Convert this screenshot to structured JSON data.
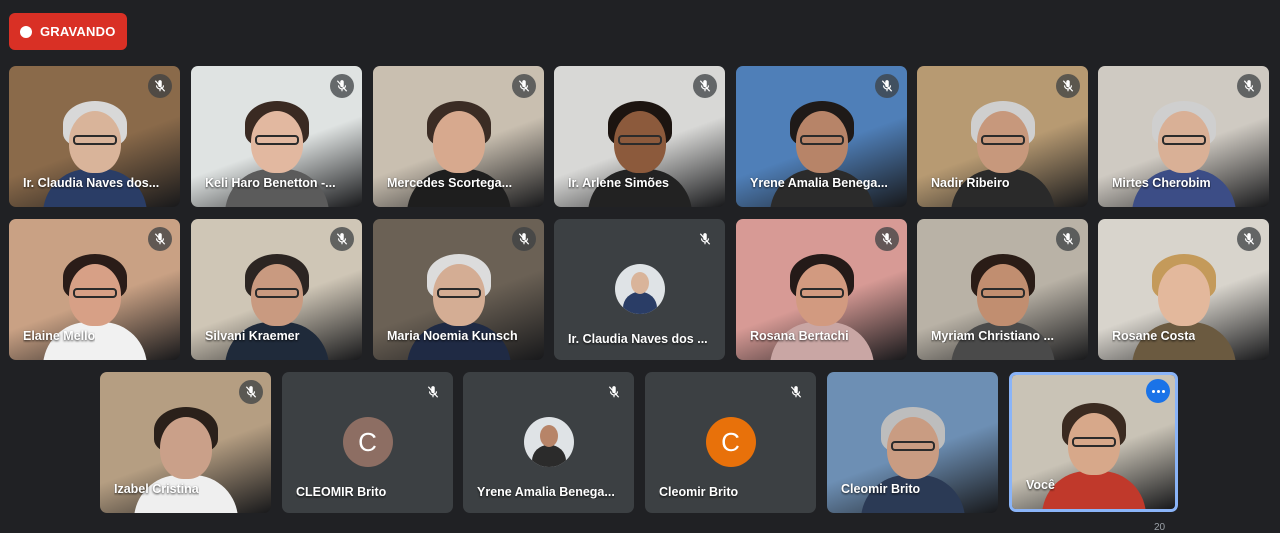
{
  "recording": {
    "label": "GRAVANDO"
  },
  "participants": [
    {
      "name": "Ir. Claudia Naves dos...",
      "muted": true,
      "bg": "#8a6a4a",
      "skin": "#d9b49a",
      "hair": "#d8d8d8",
      "shirt": "#2a3d66",
      "glasses": true
    },
    {
      "name": "Keli Haro Benetton -...",
      "muted": true,
      "bg": "#dfe3e2",
      "skin": "#e2b8a0",
      "hair": "#3a2a22",
      "shirt": "#5b5b5b",
      "glasses": true
    },
    {
      "name": "Mercedes Scortega...",
      "muted": true,
      "bg": "#c9bfb0",
      "skin": "#d7a98e",
      "hair": "#3b2c24",
      "shirt": "#1e1e1e",
      "glasses": false
    },
    {
      "name": "Ir. Arlene Simões",
      "muted": true,
      "bg": "#d8d8d6",
      "skin": "#8c5a3c",
      "hair": "#1c1410",
      "shirt": "#222222",
      "glasses": true
    },
    {
      "name": "Yrene Amalia Benega...",
      "muted": true,
      "bg": "#4f7fb8",
      "skin": "#b78468",
      "hair": "#1f1a18",
      "shirt": "#2b2b2b",
      "glasses": true
    },
    {
      "name": "Nadir Ribeiro",
      "muted": true,
      "bg": "#b79a72",
      "skin": "#c7987c",
      "hair": "#cfcfcf",
      "shirt": "#2a2a2a",
      "glasses": true
    },
    {
      "name": "Mirtes Cherobim",
      "muted": true,
      "bg": "#cfcac2",
      "skin": "#d9b096",
      "hair": "#cfcfcf",
      "shirt": "#3c4d86",
      "glasses": true
    },
    {
      "name": "Elaine Mello",
      "muted": true,
      "bg": "#c9a184",
      "skin": "#d7a086",
      "hair": "#2a1c18",
      "shirt": "#f1f1f1",
      "glasses": true
    },
    {
      "name": "Silvani Kraemer",
      "muted": true,
      "bg": "#cfc6b6",
      "skin": "#c99a80",
      "hair": "#2c2522",
      "shirt": "#1f2a3a",
      "glasses": true
    },
    {
      "name": "Maria Noemia Kunsch",
      "muted": true,
      "bg": "#6b6155",
      "skin": "#d4ad94",
      "hair": "#dcdcdc",
      "shirt": "#1f2a44",
      "glasses": true
    },
    {
      "name": "Ir. Claudia Naves dos ...",
      "muted": true,
      "avatar": "photo",
      "skin": "#d9b49a",
      "shirt": "#2a3d66"
    },
    {
      "name": "Rosana Bertachi",
      "muted": true,
      "bg": "#d79a95",
      "skin": "#d29a80",
      "hair": "#241a18",
      "shirt": "#c9a6a4",
      "glasses": true
    },
    {
      "name": "Myriam Christiano ...",
      "muted": true,
      "bg": "#b9b2a6",
      "skin": "#c18e70",
      "hair": "#2a1c16",
      "shirt": "#4a4a4a",
      "glasses": true
    },
    {
      "name": "Rosane Costa",
      "muted": true,
      "bg": "#d8d4cc",
      "skin": "#e3b89c",
      "hair": "#c49a5a",
      "shirt": "#6b5a40",
      "glasses": false
    },
    {
      "name": "Izabel Cristina",
      "muted": true,
      "bg": "#b59e82",
      "skin": "#caa089",
      "hair": "#2a201a",
      "shirt": "#efefef",
      "glasses": false
    },
    {
      "name": "CLEOMIR Brito",
      "muted": true,
      "avatar": "letter",
      "letter": "C",
      "avatar_color": "#8d6e63"
    },
    {
      "name": "Yrene Amalia Benega...",
      "muted": true,
      "avatar": "photo",
      "skin": "#b78468",
      "shirt": "#2b2b2b"
    },
    {
      "name": "Cleomir Brito",
      "muted": true,
      "avatar": "letter",
      "letter": "C",
      "avatar_color": "#e8710a"
    },
    {
      "name": "Cleomir Brito",
      "muted": false,
      "bg": "#6d8fb4",
      "skin": "#c99c82",
      "hair": "#bdbdbd",
      "shirt": "#2b3a55",
      "glasses": true
    },
    {
      "name": "Você",
      "muted": false,
      "self": true,
      "bg": "#c9c3b6",
      "skin": "#d7a88a",
      "hair": "#3a2a20",
      "shirt": "#c0392b",
      "glasses": true
    }
  ],
  "participant_count": "20"
}
